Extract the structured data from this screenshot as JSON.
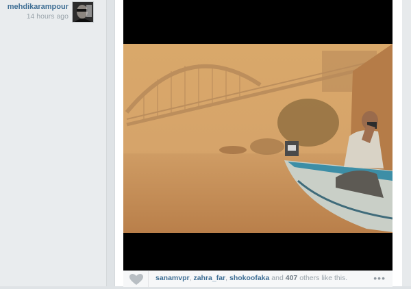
{
  "post": {
    "username": "mehdikarampour",
    "time_ago": "14 hours ago"
  },
  "likes": {
    "users": [
      "sanamvpr",
      "zahra_far",
      "shokoofaka"
    ],
    "separator": ",",
    "and_text": "and",
    "count": "407",
    "suffix": "others like this."
  },
  "icons": {
    "like": "heart-icon",
    "more": "ellipsis-icon"
  },
  "more_label": "•••"
}
